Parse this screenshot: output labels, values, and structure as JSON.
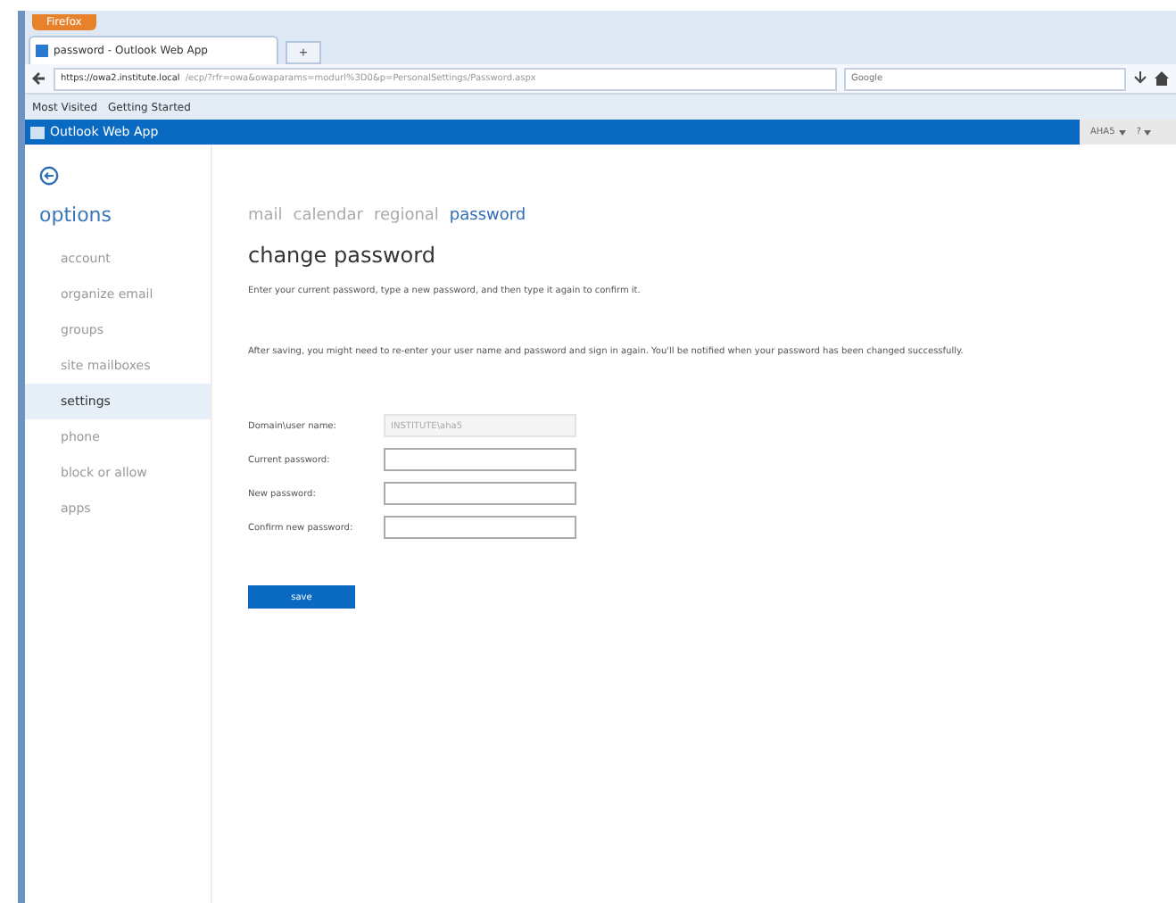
{
  "browser": {
    "menu_button": "Firefox",
    "tab_title": "password - Outlook Web App",
    "new_tab": "+",
    "url_host": "https://owa2.institute.local",
    "url_path": "/ecp/?rfr=owa&owaparams=modurl%3D0&p=PersonalSettings/Password.aspx",
    "search_placeholder": "Google",
    "bookmarks": [
      "Most Visited",
      "Getting Started"
    ]
  },
  "app": {
    "title": "Outlook Web App",
    "user": "AHA5",
    "help": "?"
  },
  "sidebar": {
    "heading": "options",
    "items": [
      {
        "label": "account",
        "selected": false
      },
      {
        "label": "organize email",
        "selected": false
      },
      {
        "label": "groups",
        "selected": false
      },
      {
        "label": "site mailboxes",
        "selected": false
      },
      {
        "label": "settings",
        "selected": true
      },
      {
        "label": "phone",
        "selected": false
      },
      {
        "label": "block or allow",
        "selected": false
      },
      {
        "label": "apps",
        "selected": false
      }
    ]
  },
  "tabs": [
    {
      "label": "mail",
      "selected": false
    },
    {
      "label": "calendar",
      "selected": false
    },
    {
      "label": "regional",
      "selected": false
    },
    {
      "label": "password",
      "selected": true
    }
  ],
  "page": {
    "heading": "change password",
    "intro": "Enter your current password, type a new password, and then type it again to confirm it.",
    "note": "After saving, you might need to re-enter your user name and password and sign in again. You'll be notified when your password has been changed successfully.",
    "fields": [
      {
        "label": "Domain\\user name:",
        "value": "INSTITUTE\\aha5",
        "disabled": true
      },
      {
        "label": "Current password:",
        "disabled": false
      },
      {
        "label": "New password:",
        "disabled": false
      },
      {
        "label": "Confirm new password:",
        "disabled": false
      }
    ],
    "save": "save"
  }
}
